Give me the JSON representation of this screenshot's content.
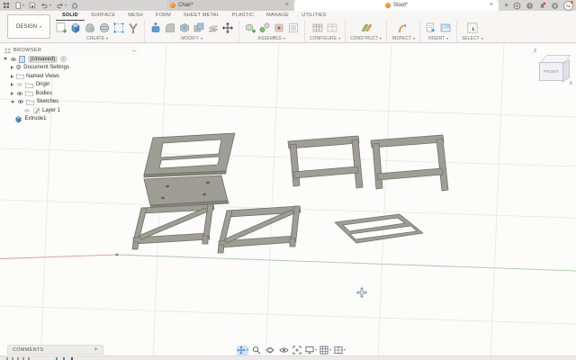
{
  "icons": {
    "close": "×",
    "add": "+",
    "minimize": "–",
    "gear": "⚙"
  },
  "colors": {
    "accent": "#0696d7",
    "part_gray": "#9e9e95",
    "part_edge": "#6f6f68",
    "active_nav_bg": "#cfe4f7"
  },
  "titlebar": {
    "document_tabs": [
      {
        "label": "Chair*",
        "active": false
      },
      {
        "label": "Stool*",
        "active": true
      }
    ],
    "avatar_initials": "AL"
  },
  "ribbon": {
    "environment_button": "DESIGN",
    "tabs": [
      {
        "label": "SOLID",
        "active": true
      },
      {
        "label": "SURFACE",
        "active": false
      },
      {
        "label": "MESH",
        "active": false
      },
      {
        "label": "FORM",
        "active": false
      },
      {
        "label": "SHEET METAL",
        "active": false
      },
      {
        "label": "PLASTIC",
        "active": false
      },
      {
        "label": "MANAGE",
        "active": false
      },
      {
        "label": "UTILITIES",
        "active": false
      }
    ],
    "groups": [
      {
        "label": "CREATE"
      },
      {
        "label": "MODIFY"
      },
      {
        "label": "ASSEMBLE"
      },
      {
        "label": "CONFIGURE"
      },
      {
        "label": "CONSTRUCT"
      },
      {
        "label": "INSPECT"
      },
      {
        "label": "INSERT"
      },
      {
        "label": "SELECT"
      }
    ]
  },
  "browser": {
    "title": "BROWSER",
    "rows": [
      {
        "label": "(Unsaved)"
      },
      {
        "label": "Document Settings"
      },
      {
        "label": "Named Views"
      },
      {
        "label": "Origin"
      },
      {
        "label": "Bodies"
      },
      {
        "label": "Sketches"
      },
      {
        "label": "Layer 1"
      },
      {
        "label": "Extrude1"
      }
    ]
  },
  "viewcube": {
    "front_label": "FRONT",
    "axes": {
      "z": "Z",
      "x": "X"
    }
  },
  "viewport": {
    "bodies": [
      "back-frame",
      "seat-plate",
      "side-frame-left",
      "side-frame-right",
      "brace-frame-left",
      "brace-frame-right",
      "flat-frame"
    ]
  },
  "comments": {
    "label": "COMMENTS"
  }
}
